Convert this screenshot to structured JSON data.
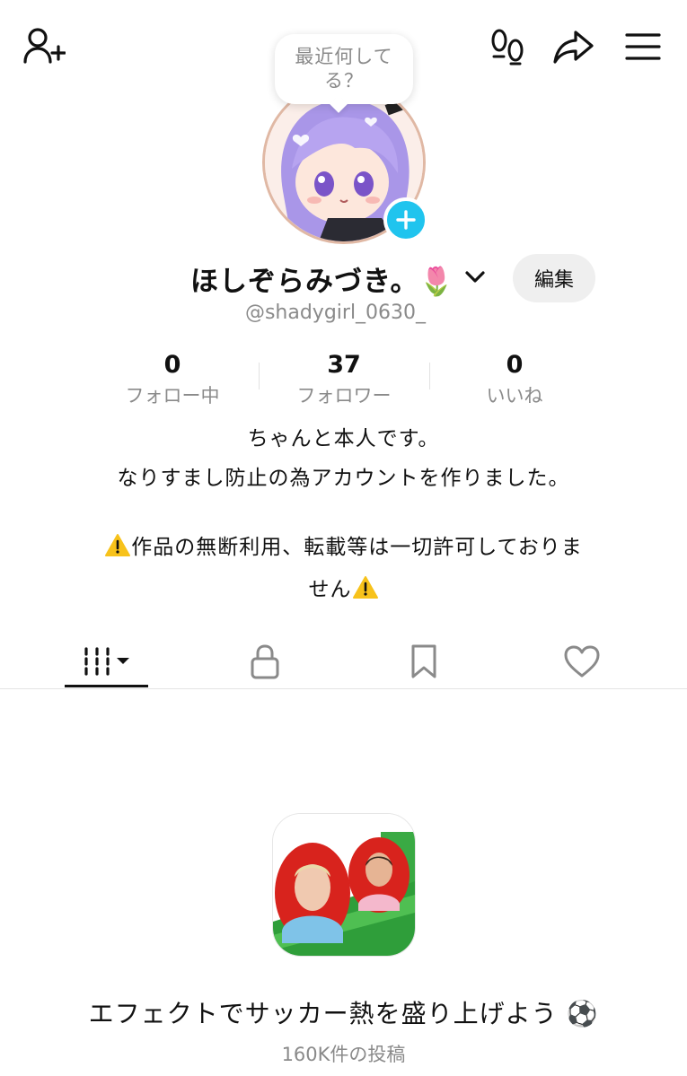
{
  "header": {
    "icons": [
      "add-friend-icon",
      "footprints-icon",
      "share-icon",
      "menu-icon"
    ]
  },
  "profile": {
    "note": "最近何してる？",
    "display_name": "ほしぞらみづき。🌷",
    "username": "@shadygirl_0630_",
    "edit_label": "編集"
  },
  "stats": [
    {
      "value": "0",
      "label": "フォロー中"
    },
    {
      "value": "37",
      "label": "フォロワー"
    },
    {
      "value": "0",
      "label": "いいね"
    }
  ],
  "bio": {
    "line1": "ちゃんと本人です。",
    "line2": "なりすまし防止の為アカウントを作りました。",
    "line3": "作品の無断利用、転載等は一切許可しておりま",
    "line4": "せん"
  },
  "tabs": {
    "icons": [
      "videos-grid-icon",
      "lock-icon",
      "bookmark-icon",
      "heart-icon"
    ],
    "active_index": 0
  },
  "effect": {
    "title": "エフェクトでサッカー熱を盛り上げよう ⚽",
    "count": "160K件の投稿"
  },
  "colors": {
    "accent_blue": "#20c4ee",
    "text_primary": "#111111",
    "text_secondary": "#8a8a8a",
    "button_bg": "#efefef"
  }
}
